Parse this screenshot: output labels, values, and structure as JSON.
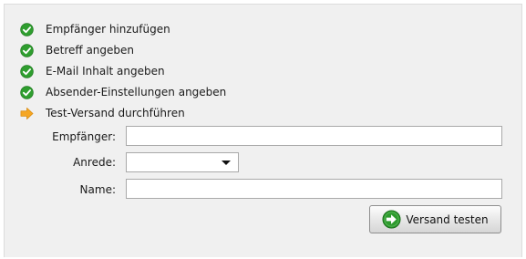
{
  "steps": [
    {
      "label": "Empfänger hinzufügen",
      "status": "done",
      "icon": "check-icon"
    },
    {
      "label": "Betreff angeben",
      "status": "done",
      "icon": "check-icon"
    },
    {
      "label": "E-Mail Inhalt angeben",
      "status": "done",
      "icon": "check-icon"
    },
    {
      "label": "Absender-Einstellungen angeben",
      "status": "done",
      "icon": "check-icon"
    },
    {
      "label": "Test-Versand durchführen",
      "status": "current",
      "icon": "arrow-right-icon"
    }
  ],
  "form": {
    "recipient_label": "Empfänger:",
    "recipient_value": "",
    "salutation_label": "Anrede:",
    "salutation_value": "",
    "name_label": "Name:",
    "name_value": ""
  },
  "actions": {
    "send_test_label": "Versand testen",
    "send_test_icon": "go-arrow-icon"
  },
  "colors": {
    "done": "#2e9e2e",
    "current": "#f3a31b",
    "panel": "#f0f0f0"
  }
}
